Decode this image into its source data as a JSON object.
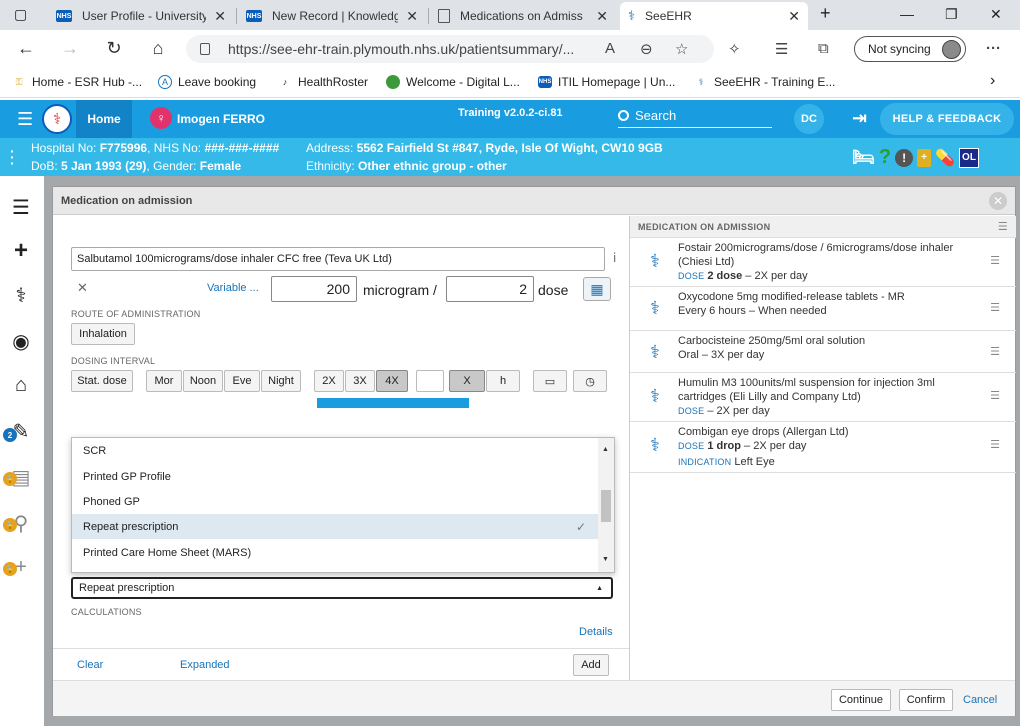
{
  "browser": {
    "tabs": [
      {
        "title": "User Profile - University",
        "icon": "nhs-favicon"
      },
      {
        "title": "New Record | Knowledg",
        "icon": "nhs-favicon"
      },
      {
        "title": "Medications on Admiss",
        "icon": "document-favicon"
      },
      {
        "title": "SeeEHR",
        "icon": "seeehr-favicon"
      }
    ],
    "new_tab": "+",
    "url": "https://see-ehr-train.plymouth.nhs.uk/patientsummary/...",
    "sync_label": "Not syncing",
    "favorites": [
      {
        "label": "Home - ESR Hub -..."
      },
      {
        "label": "Leave booking"
      },
      {
        "label": "HealthRoster"
      },
      {
        "label": "Welcome - Digital L..."
      },
      {
        "label": "ITIL Homepage | Un..."
      },
      {
        "label": "SeeEHR - Training E..."
      }
    ],
    "fav_nhs_badge": "NHS"
  },
  "app": {
    "home_label": "Home",
    "patient_name": "Imogen FERRO",
    "training_label": "Training v2.0.2-ci.81",
    "search_label": "Search",
    "user_initials": "DC",
    "help_label": "HELP & FEEDBACK",
    "patient": {
      "hospital_no_label": "Hospital No: ",
      "hospital_no": "F775996",
      "nhs_no_label": ", NHS No: ",
      "nhs_no": "###-###-####",
      "dob_label": "DoB: ",
      "dob": "5 Jan 1993 (29)",
      "gender_label": ", Gender: ",
      "gender": "Female",
      "address_label": "Address: ",
      "address": "5562 Fairfield St #847, Ryde, Isle Of Wight, CW10 9GB",
      "ethnicity_label": "Ethnicity: ",
      "ethnicity": "Other ethnic group - other",
      "ol_badge": "OL"
    },
    "sidebar_badge": "2"
  },
  "modal": {
    "title": "Medication on admission",
    "drug_value": "Salbutamol 100micrograms/dose inhaler CFC free (Teva UK Ltd)",
    "variable_label": "Variable ...",
    "dose_amount": "200",
    "dose_unit": "microgram /",
    "per_amount": "2",
    "per_unit": "dose",
    "route_label": "ROUTE OF ADMINISTRATION",
    "route_button": "Inhalation",
    "dosing_label": "DOSING INTERVAL",
    "dosing_buttons": {
      "stat": "Stat. dose",
      "mor": "Mor",
      "noon": "Noon",
      "eve": "Eve",
      "night": "Night",
      "x2": "2X",
      "x3": "3X",
      "x4": "4X",
      "x": "X",
      "h": "h"
    },
    "dropdown_items": [
      "SCR",
      "Printed GP Profile",
      "Phoned GP",
      "Repeat prescription",
      "Printed Care Home Sheet (MARS)"
    ],
    "selected_source": "Repeat prescription",
    "calculations_label": "CALCULATIONS",
    "details_link": "Details",
    "clear_link": "Clear",
    "expanded_link": "Expanded",
    "add_button": "Add",
    "right_panel": {
      "header": "MEDICATION ON ADMISSION",
      "meds": [
        {
          "name": "Fostair 200micrograms/dose / 6micrograms/dose inhaler (Chiesi Ltd)",
          "detail_key": "DOSE",
          "detail_bold": "2 dose",
          "detail_rest": " – 2X per day"
        },
        {
          "name": "Oxycodone 5mg modified-release tablets - MR",
          "detail_key": "",
          "detail_bold": "",
          "detail_rest": "Every 6 hours – When needed"
        },
        {
          "name": "Carbocisteine 250mg/5ml oral solution",
          "detail_key": "",
          "detail_bold": "",
          "detail_rest": "Oral – 3X per day"
        },
        {
          "name": "Humulin M3 100units/ml suspension for injection 3ml cartridges (Eli Lilly and Company Ltd)",
          "detail_key": "DOSE",
          "detail_bold": "",
          "detail_rest": " – 2X per day"
        },
        {
          "name": "Combigan eye drops (Allergan Ltd)",
          "detail_key": "DOSE",
          "detail_bold": "1 drop",
          "detail_rest": " – 2X per day",
          "extra_key": "INDICATION",
          "extra_val": " Left Eye"
        }
      ]
    },
    "footer": {
      "continue": "Continue",
      "confirm": "Confirm",
      "cancel": "Cancel"
    }
  }
}
